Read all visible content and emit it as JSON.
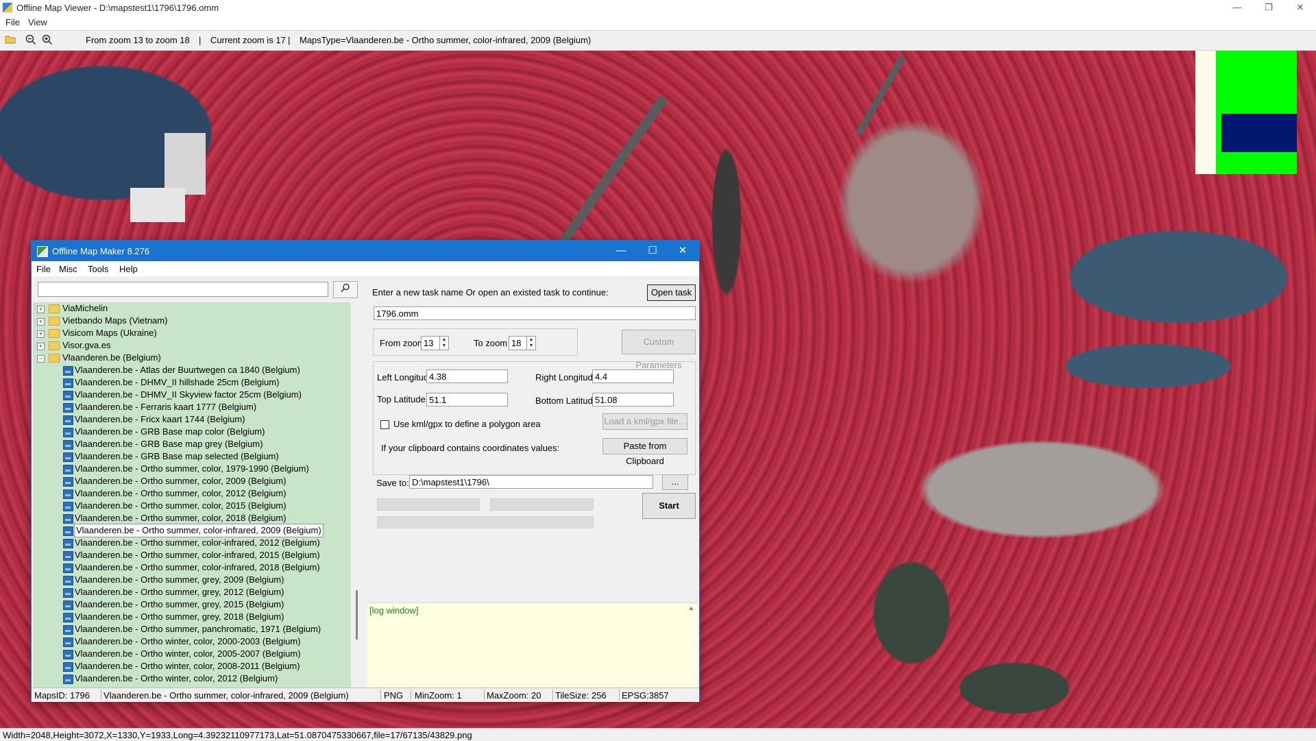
{
  "viewer": {
    "title": "Offline Map Viewer - D:\\mapstest1\\1796\\1796.omm",
    "controls": {
      "minimize": "—",
      "maximize": "❐",
      "close": "✕"
    },
    "menu": [
      "File",
      "View"
    ],
    "toolbar": {
      "open_icon": "folder-open-icon",
      "zoom_out_icon": "zoom-out-icon",
      "zoom_in_icon": "zoom-in-icon",
      "zoom_range": "From zoom 13 to zoom 18",
      "divider": "|",
      "current_zoom": "Current zoom is 17",
      "divider2": "|",
      "maps_type": "MapsType=Vlaanderen.be - Ortho summer, color-infrared, 2009 (Belgium)"
    },
    "status": "Width=2048,Height=3072,X=1330,Y=1933,Long=4.39232110977173,Lat=51.0870475330667,file=17/67135/43829.png",
    "colors": {
      "minimap_bg": "#fffbea",
      "minimap_area": "#00ff00",
      "minimap_view": "#001870"
    }
  },
  "dialog": {
    "title": "Offline Map Maker 8.276",
    "controls": {
      "minimize": "—",
      "maximize": "☐",
      "close": "✕"
    },
    "menu": [
      "File",
      "Misc",
      "Tools",
      "Help"
    ],
    "search": {
      "value": "",
      "button_icon": "search-icon"
    },
    "tree": {
      "folders": [
        {
          "label": "ViaMichelin",
          "expanded": false
        },
        {
          "label": "Vietbando Maps (Vietnam)",
          "expanded": false
        },
        {
          "label": "Visicom Maps (Ukraine)",
          "expanded": false
        },
        {
          "label": "Visor.gva.es",
          "expanded": false
        },
        {
          "label": "Vlaanderen.be (Belgium)",
          "expanded": true
        }
      ],
      "expander_collapsed": "+",
      "expander_expanded": "−",
      "items": [
        "Vlaanderen.be - Atlas der Buurtwegen ca 1840 (Belgium)",
        "Vlaanderen.be - DHMV_II hillshade 25cm (Belgium)",
        "Vlaanderen.be - DHMV_II Skyview factor 25cm (Belgium)",
        "Vlaanderen.be - Ferraris kaart 1777 (Belgium)",
        "Vlaanderen.be - Fricx kaart 1744 (Belgium)",
        "Vlaanderen.be - GRB Base map color (Belgium)",
        "Vlaanderen.be - GRB Base map grey (Belgium)",
        "Vlaanderen.be - GRB Base map selected (Belgium)",
        "Vlaanderen.be - Ortho summer, color, 1979-1990 (Belgium)",
        "Vlaanderen.be - Ortho summer, color, 2009 (Belgium)",
        "Vlaanderen.be - Ortho summer, color, 2012 (Belgium)",
        "Vlaanderen.be - Ortho summer, color, 2015 (Belgium)",
        "Vlaanderen.be - Ortho summer, color, 2018 (Belgium)",
        "Vlaanderen.be - Ortho summer, color-infrared, 2009 (Belgium)",
        "Vlaanderen.be - Ortho summer, color-infrared, 2012 (Belgium)",
        "Vlaanderen.be - Ortho summer, color-infrared, 2015 (Belgium)",
        "Vlaanderen.be - Ortho summer, color-infrared, 2018 (Belgium)",
        "Vlaanderen.be - Ortho summer, grey, 2009 (Belgium)",
        "Vlaanderen.be - Ortho summer, grey, 2012 (Belgium)",
        "Vlaanderen.be - Ortho summer, grey, 2015 (Belgium)",
        "Vlaanderen.be - Ortho summer, grey, 2018 (Belgium)",
        "Vlaanderen.be - Ortho summer, panchromatic, 1971 (Belgium)",
        "Vlaanderen.be - Ortho winter, color, 2000-2003 (Belgium)",
        "Vlaanderen.be - Ortho winter, color, 2005-2007 (Belgium)",
        "Vlaanderen.be - Ortho winter, color, 2008-2011 (Belgium)",
        "Vlaanderen.be - Ortho winter, color, 2012 (Belgium)"
      ],
      "selected": "Vlaanderen.be - Ortho summer, color-infrared, 2009 (Belgium)"
    },
    "task": {
      "prompt": "Enter a new task name Or open an existed task to continue:",
      "open_button": "Open task ...",
      "name_value": "1796.omm"
    },
    "zoom": {
      "from_label": "From zoom",
      "from_value": "13",
      "to_label": "To zoom",
      "to_value": "18",
      "spin_up": "▲",
      "spin_down": "▼",
      "custom_button": "Custom Parameters"
    },
    "coords": {
      "left_lon_label": "Left Longitude",
      "left_lon": "4.38",
      "right_lon_label": "Right Longitude",
      "right_lon": "4.4",
      "top_lat_label": "Top Latitude",
      "top_lat": "51.1",
      "bottom_lat_label": "Bottom Latitude",
      "bottom_lat": "51.08",
      "kml_label": "Use kml/gpx to define a polygon area",
      "kml_checked": false,
      "kml_button": "Load a kml/gpx file...",
      "clipboard_label": "If your clipboard contains coordinates values:",
      "clipboard_button": "Paste from Clipboard"
    },
    "save": {
      "label": "Save to:",
      "value": "D:\\mapstest1\\1796\\",
      "browse": "...",
      "start": "Start"
    },
    "log": {
      "text": "[log window]",
      "scroll_up": "▲",
      "scroll_down": "▼"
    },
    "status": {
      "maps_id": "MapsID: 1796",
      "map_name": "Vlaanderen.be - Ortho summer, color-infrared, 2009 (Belgium)",
      "format": "PNG",
      "min_zoom": "MinZoom: 1",
      "max_zoom": "MaxZoom: 20",
      "tile_size": "TileSize: 256",
      "epsg": "EPSG:3857"
    }
  }
}
